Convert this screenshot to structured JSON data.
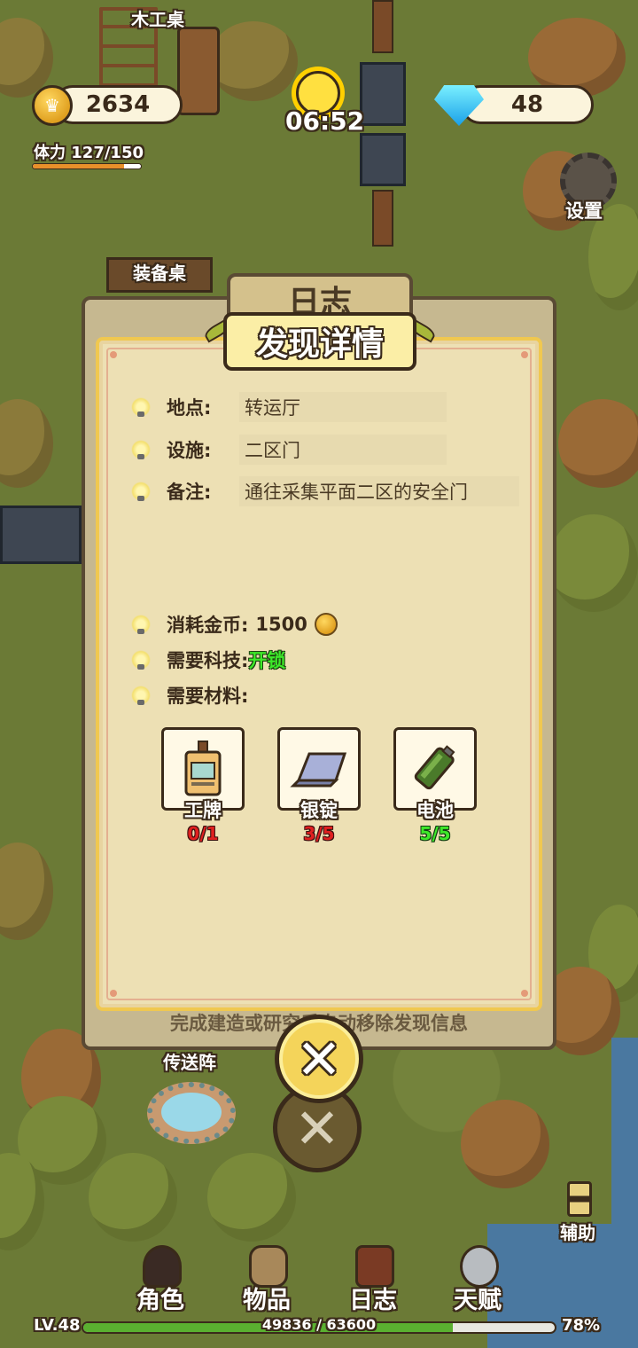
{
  "hud": {
    "coins": "2634",
    "gems": "48",
    "time": "06:52",
    "stamina_label": "体力 127/150",
    "stamina_fraction": 0.8467,
    "settings_label": "设置"
  },
  "map_labels": {
    "carpentry_table": "木工桌",
    "equipment_table": "装备桌",
    "teleport_array": "传送阵",
    "assist": "辅助"
  },
  "dialog": {
    "tab_label": "日志",
    "title": "发现详情",
    "info": [
      {
        "label": "地点:",
        "value": "转运厅"
      },
      {
        "label": "设施:",
        "value": "二区门"
      },
      {
        "label": "备注:",
        "value": "通往采集平面二区的安全门"
      }
    ],
    "cost_label": "消耗金币:",
    "cost_value": "1500",
    "tech_label": "需要科技:",
    "tech_value": "开锁",
    "materials_label": "需要材料:",
    "materials": [
      {
        "name": "工牌",
        "count": "0/1",
        "status": "insufficient",
        "icon": "id-badge-icon"
      },
      {
        "name": "银锭",
        "count": "3/5",
        "status": "insufficient",
        "icon": "silver-ingot-icon"
      },
      {
        "name": "电池",
        "count": "5/5",
        "status": "sufficient",
        "icon": "battery-icon"
      }
    ],
    "hint": "完成建造或研究后自动移除发现信息",
    "close_symbol": "✕"
  },
  "nav": {
    "items": [
      {
        "label": "角色",
        "icon": "character-icon"
      },
      {
        "label": "物品",
        "icon": "backpack-icon"
      },
      {
        "label": "日志",
        "icon": "journal-icon"
      },
      {
        "label": "天赋",
        "icon": "talent-wings-icon"
      }
    ],
    "level": "LV.48",
    "xp": "49836 / 63600",
    "xp_fraction": 0.7836,
    "percent": "78%"
  },
  "colors": {
    "grass": "#6b7a36",
    "panel": "#ede0b4",
    "banner": "#fbeea6",
    "red": "#e02020",
    "green": "#3ee82a"
  }
}
